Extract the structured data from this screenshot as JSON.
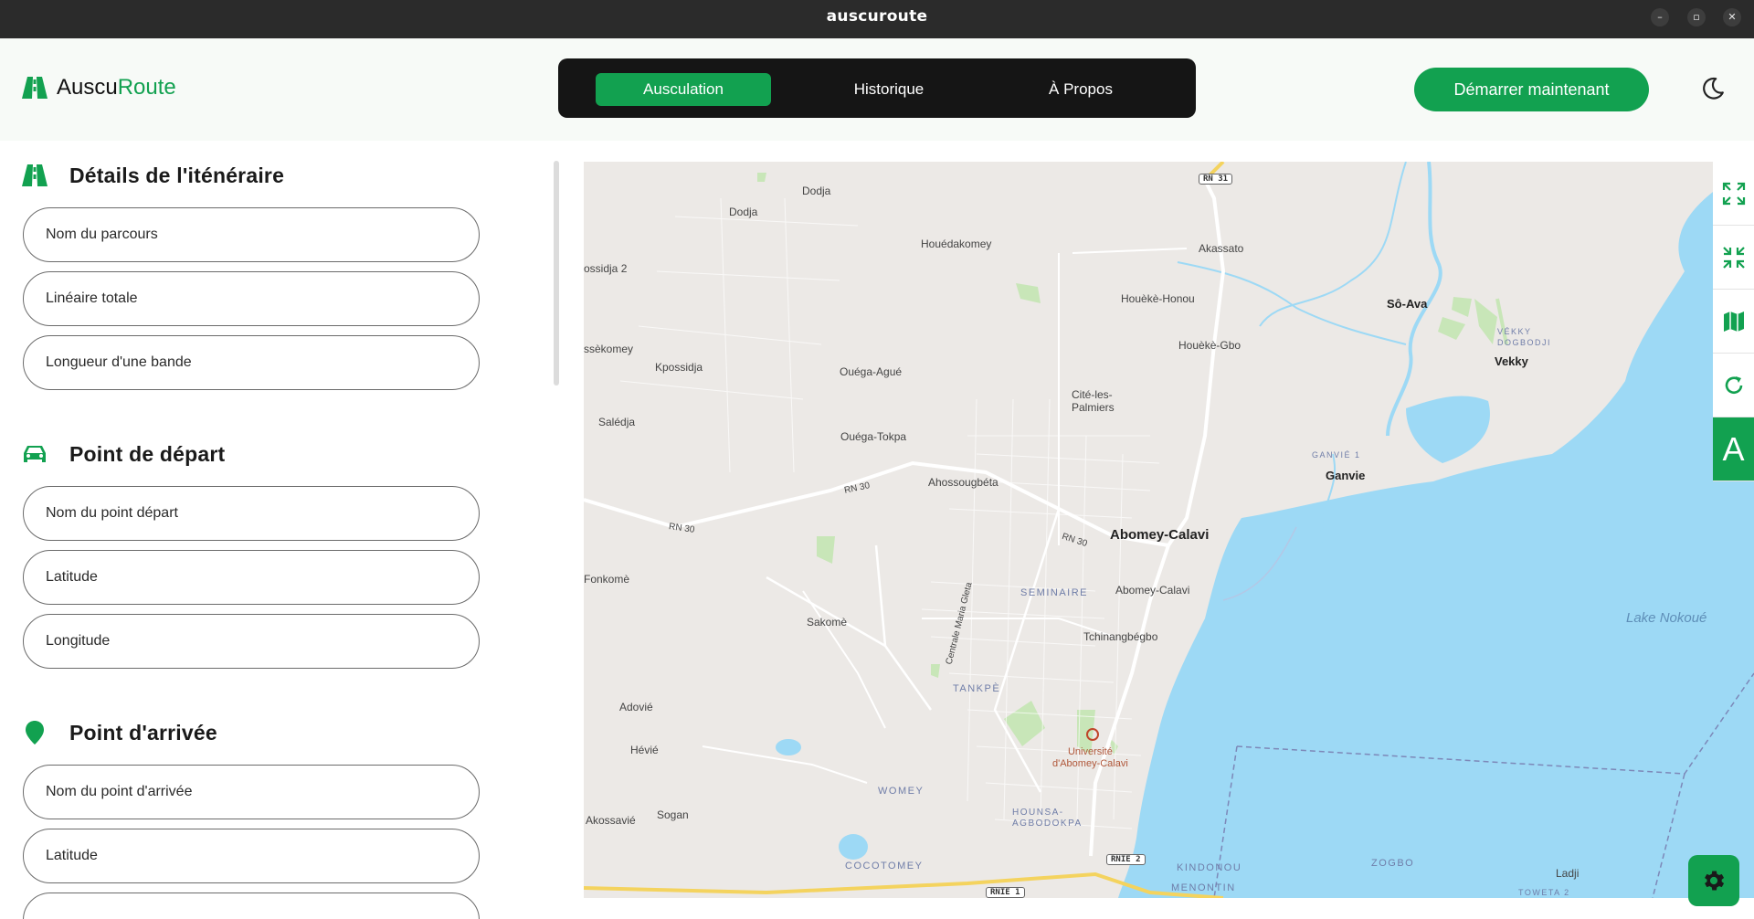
{
  "window": {
    "title": "auscuroute",
    "minimize_icon": "minimize-icon",
    "maximize_icon": "restore-icon",
    "close_icon": "close-icon",
    "minimize_glyph": "–",
    "maximize_glyph": "▫",
    "close_glyph": "✕"
  },
  "header": {
    "logo_part1": "Auscu",
    "logo_part2": "Route",
    "tabs": [
      {
        "label": "Ausculation",
        "active": true
      },
      {
        "label": "Historique",
        "active": false
      },
      {
        "label": "À Propos",
        "active": false
      }
    ],
    "cta_label": "Démarrer maintenant",
    "theme_icon": "moon-icon"
  },
  "colors": {
    "accent": "#12a150",
    "tabbar": "#151515",
    "water": "#9dd9f5"
  },
  "sections": [
    {
      "title": "Détails de l'iténéraire",
      "icon": "road-icon",
      "fields": [
        {
          "placeholder": "Nom du parcours"
        },
        {
          "placeholder": "Linéaire totale"
        },
        {
          "placeholder": "Longueur d'une bande"
        }
      ]
    },
    {
      "title": "Point de départ",
      "icon": "car-icon",
      "fields": [
        {
          "placeholder": "Nom du point départ"
        },
        {
          "placeholder": "Latitude"
        },
        {
          "placeholder": "Longitude"
        }
      ]
    },
    {
      "title": "Point d'arrivée",
      "icon": "map-pin-icon",
      "fields": [
        {
          "placeholder": "Nom du point d'arrivée"
        },
        {
          "placeholder": "Latitude"
        },
        {
          "placeholder": ""
        }
      ]
    }
  ],
  "map": {
    "labels": {
      "dodja": "Dodja",
      "dodja2": "Dodja",
      "houedakomey": "Houédakomey",
      "akassato": "Akassato",
      "ossidja": "ossidja 2",
      "houeke_honou": "Houèkè-Honou",
      "so_ava": "Sô-Ava",
      "houeke_gbo": "Houèkè-Gbo",
      "vekky_dog": "VÉKKY\nDOGBODJI",
      "vekky": "Vekky",
      "ssekomey": "ssèkomey",
      "kpossidja": "Kpossidja",
      "ouega_ague": "Ouéga-Agué",
      "cite_palmiers": "Cité-les-\nPalmiers",
      "saledja": "Salédja",
      "ouega_tokpa": "Ouéga-Tokpa",
      "ganvie1": "GANVIÉ 1",
      "ganvie": "Ganvie",
      "ahossougbeta": "Ahossougbéta",
      "rn30a": "RN 30",
      "rn30b": "RN 30",
      "rn30c": "RN 30",
      "abomey_calavi": "Abomey-Calavi",
      "fonkome": "Fonkomè",
      "centrale": "Centrale Maria Gleta",
      "seminaire": "SEMINAIRE",
      "abomey_calavi2": "Abomey-Calavi",
      "lake": "Lake Nokoué",
      "sakome": "Sakomè",
      "tchinangbegbo": "Tchinangbégbo",
      "tankpe": "TANKPÈ",
      "adovie": "Adovié",
      "universite": "Université\nd'Abomey-Calavi",
      "hevie": "Hévié",
      "womey": "WOMEY",
      "hounsa": "HOUNSA-\nAGBODOKPA",
      "akossavie": "Akossavié",
      "sogan": "Sogan",
      "cocotomey": "COCOTOMEY",
      "kindonou": "KINDONOU",
      "zogbo": "ZOGBO",
      "ladji": "Ladji",
      "menontin": "MENONTIN",
      "towfeta": "TOWETA 2"
    },
    "shields": {
      "rn31": "RN 31",
      "rnie2": "RNIE 2",
      "rnie1": "RNIE 1"
    },
    "controls": [
      {
        "icon": "expand-icon"
      },
      {
        "icon": "collapse-icon"
      },
      {
        "icon": "map-icon"
      },
      {
        "icon": "refresh-icon"
      },
      {
        "icon": "font-icon",
        "glyph": "A"
      }
    ],
    "settings_icon": "gear-icon"
  }
}
